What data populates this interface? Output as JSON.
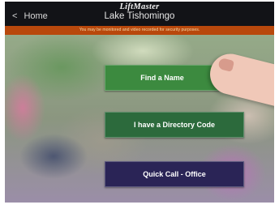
{
  "header": {
    "brand": "LiftMaster",
    "site_name": "Lake Tishomingo",
    "home_label": "Home",
    "back_icon": "chevron-left-icon"
  },
  "notice": {
    "text": "You may be monitored and video recorded for security purposes."
  },
  "actions": [
    {
      "label": "Find a Name",
      "color": "#3c8a3f"
    },
    {
      "label": "I have a Directory Code",
      "color": "#2c6a3c"
    },
    {
      "label": "Quick Call - Office",
      "color": "#2a2456"
    }
  ]
}
